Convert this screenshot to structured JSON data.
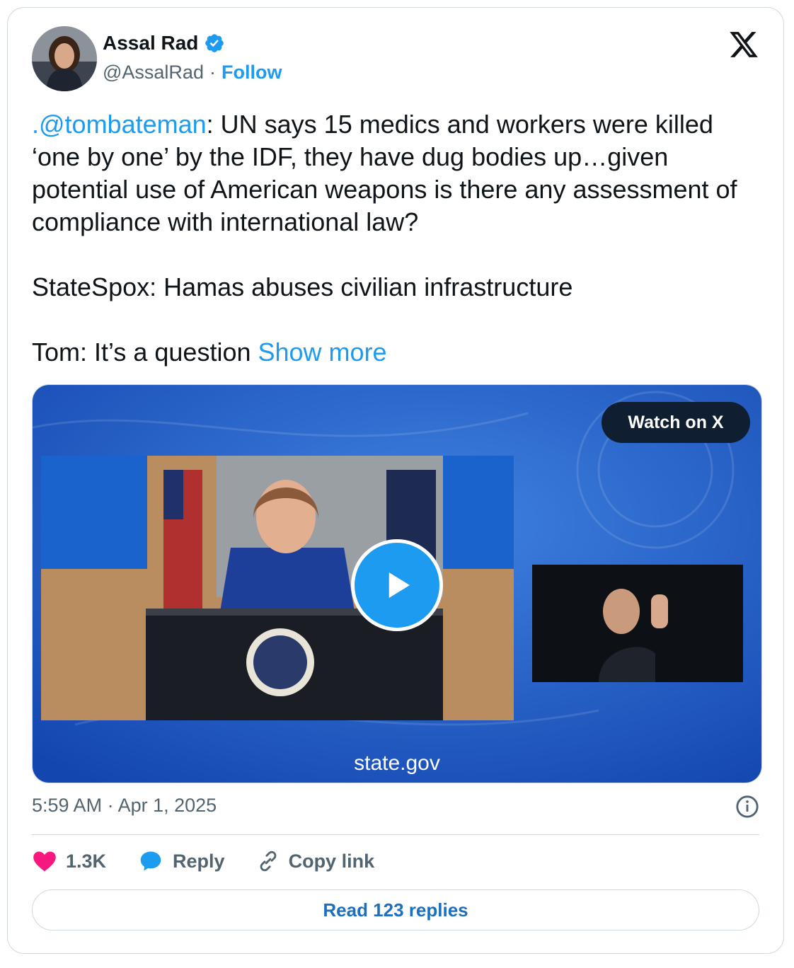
{
  "author": {
    "name": "Assal Rad",
    "handle": "@AssalRad",
    "separator": "·",
    "follow_label": "Follow"
  },
  "tweet": {
    "mention": ".@tombateman",
    "text_after_mention": ": UN says 15 medics and workers were killed ‘one by one’ by the IDF, they have dug bodies up…given potential use of American weapons is there any assessment of compliance with international law?\n\nStateSpox: Hamas abuses civilian infrastructure\n\nTom: It’s a question ",
    "show_more": "Show more"
  },
  "media": {
    "watch_label": "Watch on X",
    "source_label": "state.gov"
  },
  "timestamp": "5:59 AM · Apr 1, 2025",
  "actions": {
    "likes": "1.3K",
    "reply_label": "Reply",
    "copy_label": "Copy link"
  },
  "read_replies_label": "Read 123 replies",
  "icons": [
    "verified-badge-icon",
    "x-logo-icon",
    "play-icon",
    "info-icon",
    "heart-icon",
    "reply-bubble-icon",
    "link-icon"
  ],
  "colors": {
    "accent": "#1d9bf0",
    "heart": "#f91880",
    "muted": "#536471",
    "media_bg": "#1f5cc4"
  }
}
